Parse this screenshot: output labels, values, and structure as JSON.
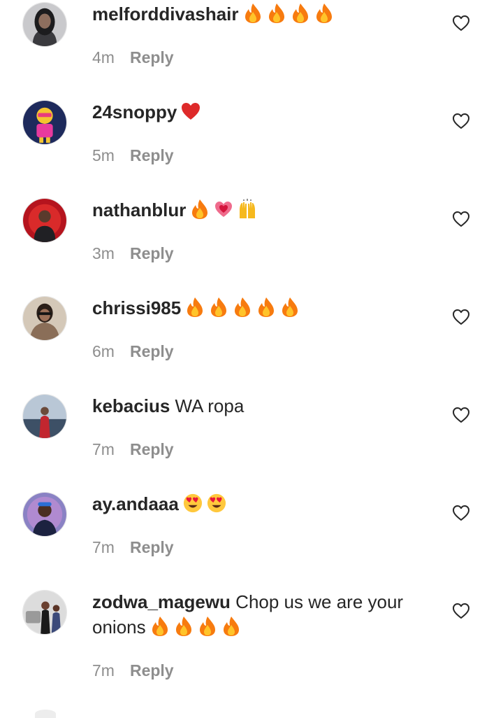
{
  "comments": [
    {
      "username": "melforddivashair",
      "text": "",
      "emojis": [
        "fire-emoji",
        "fire-emoji",
        "fire-emoji",
        "fire-emoji"
      ],
      "time": "4m",
      "reply_label": "Reply"
    },
    {
      "username": "24snoppy",
      "text": "",
      "emojis": [
        "red-heart-emoji"
      ],
      "time": "5m",
      "reply_label": "Reply"
    },
    {
      "username": "nathanblur",
      "text": "",
      "emojis": [
        "fire-emoji",
        "sparkling-heart-emoji",
        "raising-hands-emoji"
      ],
      "time": "3m",
      "reply_label": "Reply"
    },
    {
      "username": "chrissi985",
      "text": "",
      "emojis": [
        "fire-emoji",
        "fire-emoji",
        "fire-emoji",
        "fire-emoji",
        "fire-emoji"
      ],
      "time": "6m",
      "reply_label": "Reply"
    },
    {
      "username": "kebacius",
      "text": "WA ropa",
      "emojis": [],
      "time": "7m",
      "reply_label": "Reply"
    },
    {
      "username": "ay.andaaa",
      "text": "",
      "emojis": [
        "heart-eyes-emoji",
        "heart-eyes-emoji"
      ],
      "time": "7m",
      "reply_label": "Reply"
    },
    {
      "username": "zodwa_magewu",
      "text": "Chop us we are your onions",
      "emojis": [
        "fire-emoji",
        "fire-emoji",
        "fire-emoji",
        "fire-emoji"
      ],
      "time": "7m",
      "reply_label": "Reply"
    }
  ],
  "colors": {
    "primary_text": "#262626",
    "secondary_text": "#8e8e8e",
    "background": "#ffffff"
  },
  "icons": {
    "like": "heart-outline-icon"
  }
}
